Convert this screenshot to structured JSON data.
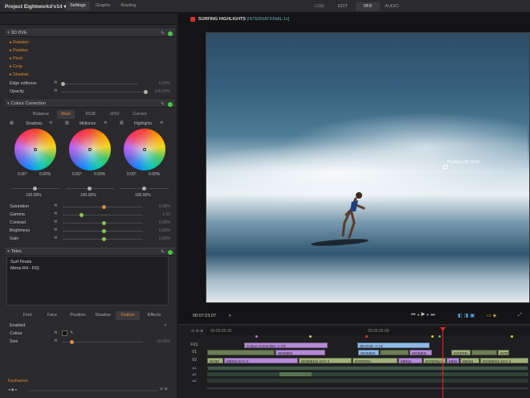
{
  "app": {
    "title": "Project Eightworks v14",
    "title_chevron": "▾"
  },
  "modes": [
    {
      "label": "LOG",
      "active": false
    },
    {
      "label": "EDIT",
      "active": false
    },
    {
      "label": "VFX",
      "active": true
    },
    {
      "label": "AUDIO",
      "active": false
    }
  ],
  "left_tabs": {
    "plus": "+",
    "settings": "Settings",
    "graphs": "Graphs",
    "routing": "Routing"
  },
  "dve": {
    "header": "3D DVE",
    "items": [
      "Rotation",
      "Position",
      "Pivot",
      "Crop",
      "Shadow"
    ],
    "edge_softness": {
      "label": "Edge softness",
      "value": "0.00%"
    },
    "opacity": {
      "label": "Opacity",
      "value": "100.00%"
    }
  },
  "cc": {
    "header": "Colour Correction",
    "tabs": [
      "Balance",
      "Main",
      "RGB",
      "HSV",
      "Curves"
    ],
    "active_tab": "Main",
    "wheels": [
      {
        "label": "Shadows",
        "angle": "0.00°",
        "amount": "0.00%",
        "level": "100.00%"
      },
      {
        "label": "Midtones",
        "angle": "0.00°",
        "amount": "0.00%",
        "level": "100.00%"
      },
      {
        "label": "Highlights",
        "angle": "0.00°",
        "amount": "0.00%",
        "level": "100.00%"
      }
    ],
    "params": [
      {
        "label": "Saturation",
        "value": "0.98%"
      },
      {
        "label": "Gamma",
        "value": "1.00"
      },
      {
        "label": "Contrast",
        "value": "0.00%"
      },
      {
        "label": "Brightness",
        "value": "0.00%"
      },
      {
        "label": "Gain",
        "value": "0.00%"
      }
    ]
  },
  "titles": {
    "header": "Titles",
    "line1": "Surf Finals",
    "line2": "Mens R4 - FD|",
    "tabs": [
      "Font",
      "Face",
      "Position",
      "Shadow",
      "Outline",
      "Effects"
    ],
    "active_tab": "Outline",
    "enabled_label": "Enabled",
    "enabled_check": "✓",
    "colour_label": "Colour",
    "size_label": "Size",
    "size_value": "10.00%"
  },
  "keyframes_label": "Keyframes",
  "viewer": {
    "title": "SURFING HIGHLIGHTS",
    "subtitle": "[INTERNATIONAL 1x]",
    "overlay_label": "Position (3D DVE)",
    "timecode": "00:07:23.07"
  },
  "timeline": {
    "ruler": [
      "00:00:00.00",
      "00:05:00.00"
    ],
    "tracks": [
      "FX1",
      "V1",
      "V2",
      "A1",
      "A2",
      "A3"
    ],
    "fx_clips": [
      {
        "label": "Colour Correction -> V2"
      },
      {
        "label": "3D DVE -> V1"
      }
    ],
    "v1_clips": [
      "WOMEN",
      "WOMEN",
      "WOMEN",
      "INTERN",
      "INTE"
    ],
    "v2_clips": [
      "WOM",
      "MENS DAY 3",
      "WOMENS DAY 2",
      "INTERNA",
      "MENS",
      "INTERNA",
      "MEN",
      "MENS",
      "WOMENS DAY 2"
    ]
  },
  "colors": {
    "accent": "#e08a2c",
    "active_green": "#4cc44a",
    "playhead": "#e02a2a"
  }
}
